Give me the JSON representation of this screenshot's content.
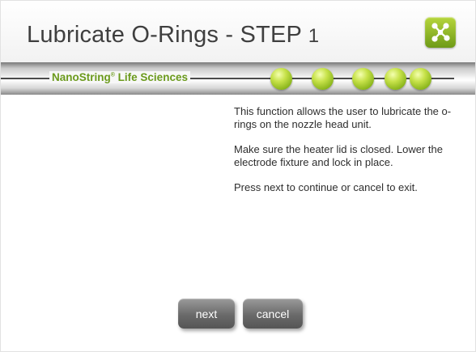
{
  "header": {
    "title_main": "Lubricate O-Rings - STEP ",
    "title_step": "1",
    "logo_icon": "network-molecule-icon"
  },
  "progress": {
    "brand_name": "NanoString",
    "brand_mark": "®",
    "brand_suffix": " Life Sciences",
    "step_dots": 5,
    "dot_color": "#a8cc2c"
  },
  "content": {
    "paragraph_1": "This function allows the user to lubricate the o-rings on the nozzle head unit.",
    "paragraph_2": "Make sure the heater lid is closed. Lower the electrode fixture and lock in place.",
    "paragraph_3": "Press next to continue or cancel to exit."
  },
  "buttons": {
    "next_label": "next",
    "cancel_label": "cancel"
  },
  "colors": {
    "accent_green": "#6b9a1c",
    "button_gray": "#6a6a6a"
  }
}
